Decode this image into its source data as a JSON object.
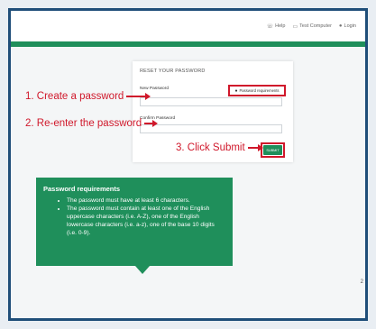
{
  "nav": {
    "help": "Help",
    "test_computer": "Test Computer",
    "login": "Login",
    "help_icon": "phone-icon",
    "test_icon": "monitor-icon",
    "login_icon": "user-icon"
  },
  "card": {
    "title": "RESET YOUR PASSWORD",
    "new_password_label": "New Password",
    "confirm_password_label": "Confirm Password",
    "requirements_button": "Password requirements",
    "submit_button": "SUBMIT"
  },
  "annotations": {
    "step1": "1. Create a password",
    "step2": "2. Re-enter the password",
    "step3": "3. Click Submit"
  },
  "tooltip": {
    "title": "Password requirements",
    "items": [
      "The password must have at least 6 characters.",
      "The password must contain at least one of the English uppercase characters (i.e. A-Z), one of the English lowercase characters (i.e. a-z), one of the base 10 digits (i.e. 0-9)."
    ]
  },
  "page_number": "2",
  "colors": {
    "accent_green": "#1f8f5b",
    "annotation_red": "#d0182b",
    "frame_border": "#1f4e79"
  }
}
